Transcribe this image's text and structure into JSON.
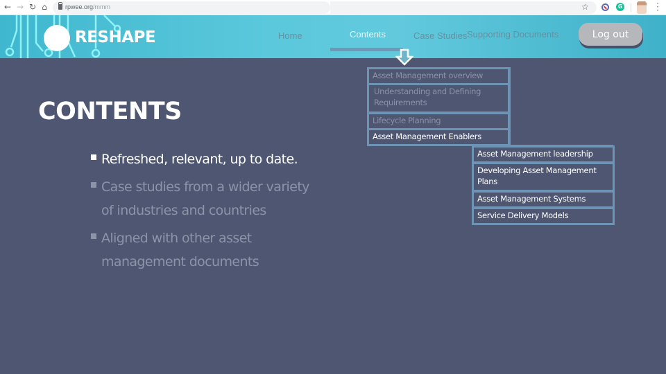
{
  "browser": {
    "url_host": "rpwee.org",
    "url_path": "/mmm",
    "back_icon": "arrow-left",
    "forward_icon": "arrow-right",
    "reload_icon": "reload",
    "home_icon": "home",
    "bookmark_icon": "star",
    "extensions": [
      "privacy-extension",
      "grammarly-extension"
    ],
    "grammarly_letter": "G",
    "menu_icon": "vertical-dots"
  },
  "header": {
    "logo_text": "RESHAPE",
    "nav": [
      {
        "label": "Home",
        "active": false
      },
      {
        "label": "Contents",
        "active": true
      },
      {
        "label": "Case Studies",
        "active": false
      },
      {
        "label": "Supporting Documents",
        "active": false
      }
    ],
    "logout_label": "Log out"
  },
  "main": {
    "title": "CONTENTS",
    "bullets": [
      {
        "lines": [
          "Refreshed,  relevant, up to date."
        ],
        "active": true
      },
      {
        "lines": [
          "Case studies from a wider variety",
          "of industries and countries"
        ],
        "active": false
      },
      {
        "lines": [
          "Aligned with other asset",
          "management documents"
        ],
        "active": false
      }
    ]
  },
  "menu_tree": {
    "level1": [
      {
        "label": "Asset Management overview",
        "active": false
      },
      {
        "label": "Understanding and Defining Requirements",
        "active": false
      },
      {
        "label": "Lifecycle Planning",
        "active": false
      },
      {
        "label": "Asset Management Enablers",
        "active": true
      }
    ],
    "level2": [
      {
        "label": "Asset Management leadership"
      },
      {
        "label": "Developing Asset Management Plans"
      },
      {
        "label": "Asset Management Systems"
      },
      {
        "label": "Service Delivery Models"
      }
    ]
  },
  "colors": {
    "header_bg": "#5bc8dc",
    "page_bg": "#4f5672",
    "box_border": "#6d93b5",
    "nav_inactive": "#6b8f9e",
    "logout_bg": "#b6b7bb"
  }
}
